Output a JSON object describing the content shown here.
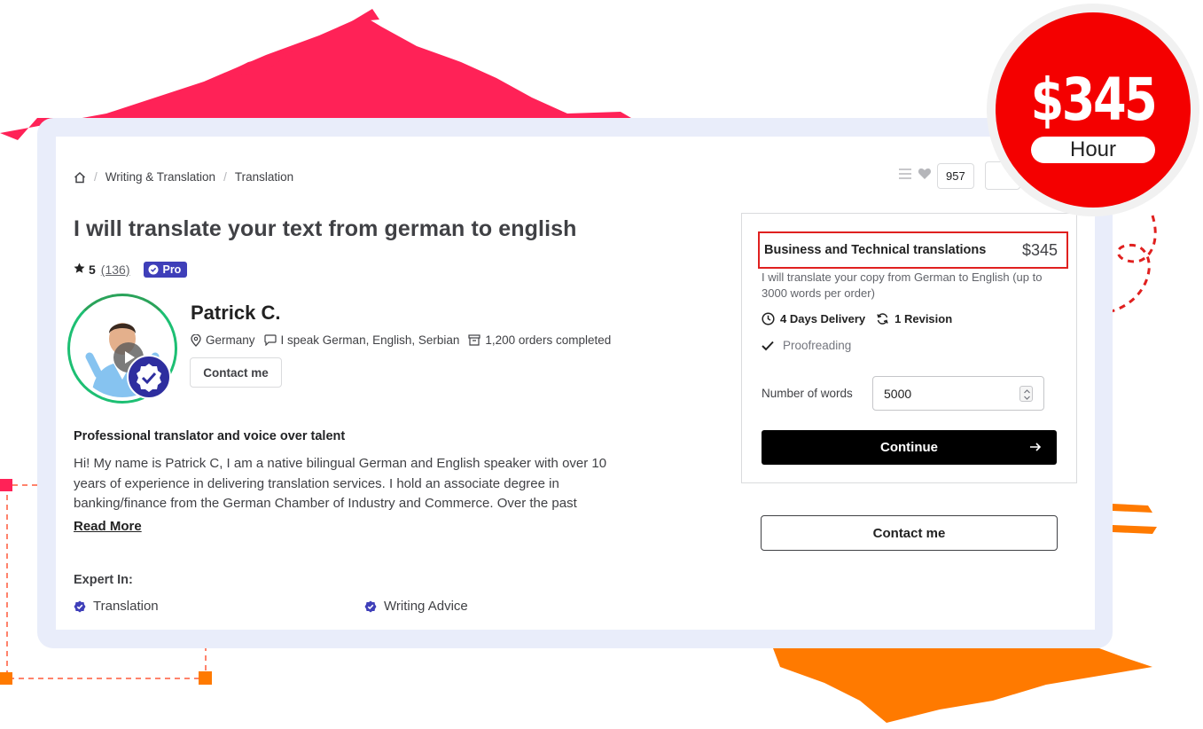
{
  "breadcrumb": {
    "items": [
      "Writing & Translation",
      "Translation"
    ]
  },
  "favorites": {
    "count": "957"
  },
  "gig": {
    "title": "I will translate your text from german to english",
    "rating": "5",
    "reviews": "(136)",
    "badge": "Pro"
  },
  "seller": {
    "name": "Patrick C.",
    "country": "Germany",
    "languages": "I speak German, English, Serbian",
    "orders": "1,200 orders completed",
    "contact_label": "Contact me"
  },
  "about": {
    "heading": "Professional translator and voice over talent",
    "text": "Hi!  My name is Patrick C, I am a native bilingual German and English speaker with over 10 years of experience in delivering translation services.  I hold an associate degree in banking/finance from the German Chamber of Industry and Commerce. Over the past",
    "read_more": "Read More"
  },
  "expertise": {
    "heading": "Expert In:",
    "items": [
      "Translation",
      "Writing Advice"
    ]
  },
  "package": {
    "name": "Business and Technical translations",
    "price": "$345",
    "description": "I will translate your copy from German to English (up to 3000 words per order)",
    "delivery": "4 Days Delivery",
    "revisions": "1 Revision",
    "feature": "Proofreading",
    "words_label": "Number of words",
    "words_value": "5000",
    "continue_label": "Continue",
    "contact_label": "Contact me"
  },
  "promo": {
    "price": "$345",
    "unit": "Hour"
  },
  "colors": {
    "accent_red": "#f40000",
    "brush_pink": "#ff2257",
    "brush_orange": "#ff7a00",
    "pro_badge": "#3f3fb9",
    "online_green": "#1dbf73"
  },
  "icons": [
    "home-icon",
    "menu-icon",
    "heart-icon",
    "star-icon",
    "shield-check-icon",
    "play-icon",
    "verified-icon",
    "location-icon",
    "chat-icon",
    "orders-icon",
    "clock-icon",
    "refresh-icon",
    "check-icon",
    "arrow-right-icon"
  ]
}
